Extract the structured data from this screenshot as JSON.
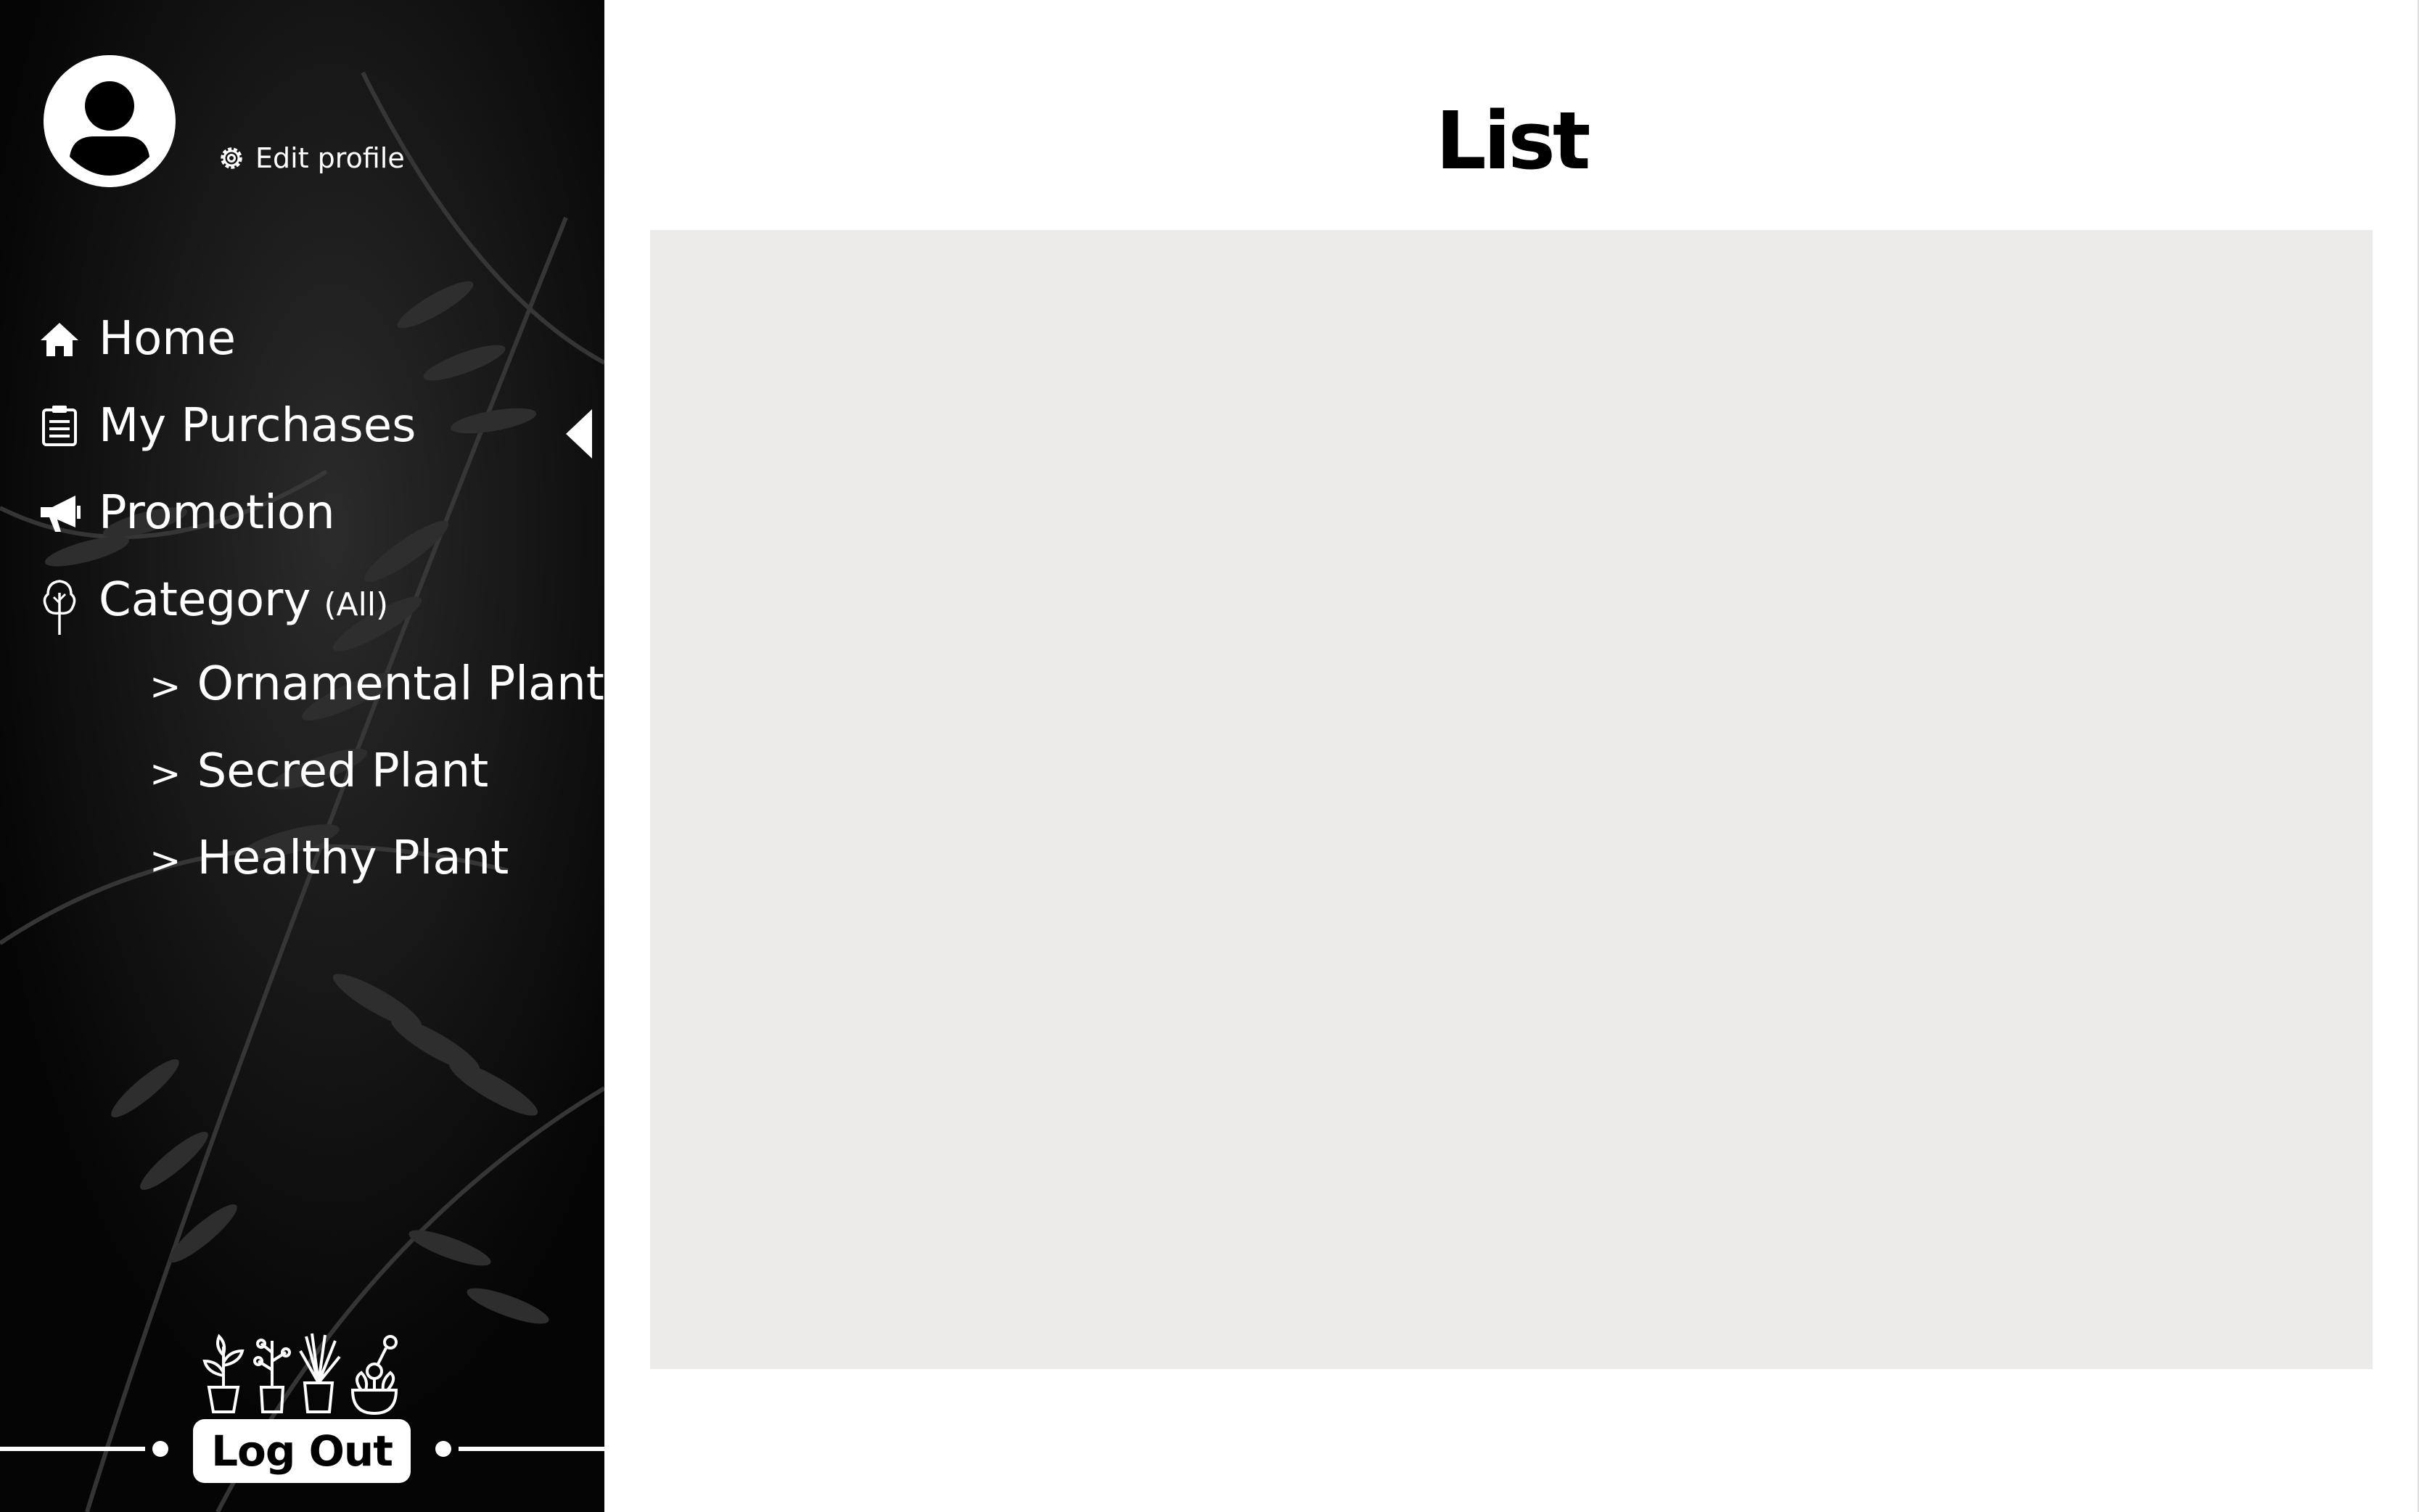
{
  "sidebar": {
    "edit_profile_label": "Edit profile",
    "nav": {
      "home": "Home",
      "purchases": "My Purchases",
      "promotion": "Promotion",
      "category": "Category",
      "category_note": "(All)"
    },
    "subcategories": [
      {
        "chevron": ">",
        "label": "Ornamental Plant"
      },
      {
        "chevron": ">",
        "label": "Secred Plant"
      },
      {
        "chevron": ">",
        "label": "Healthy Plant"
      }
    ],
    "logout_label": "Log Out"
  },
  "main": {
    "title": "List"
  },
  "colors": {
    "sidebar_bg": "#050505",
    "list_bg": "#ecebe9",
    "text_light": "#ffffff",
    "text_dark": "#000000"
  },
  "icons": {
    "avatar": "user-avatar-icon",
    "edit": "gear-icon",
    "home": "home-icon",
    "purchases": "clipboard-icon",
    "promotion": "megaphone-icon",
    "category": "tree-icon",
    "collapse": "triangle-left-icon",
    "plants": "potted-plants-icon"
  }
}
